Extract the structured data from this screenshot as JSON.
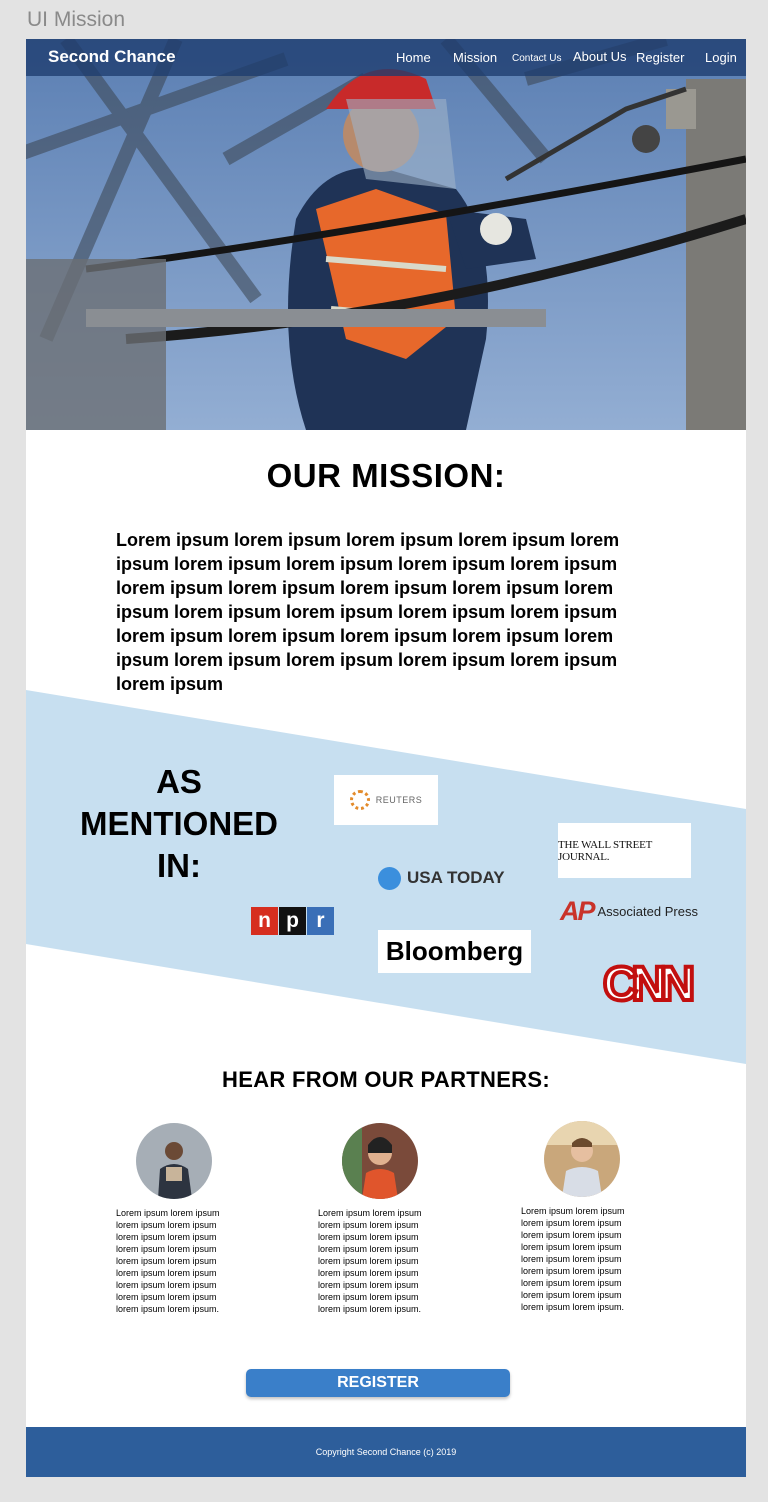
{
  "window": {
    "title": "UI Mission"
  },
  "nav": {
    "brand": "Second Chance",
    "items": [
      "Home",
      "Mission",
      "Contact Us",
      "About Us",
      "Register",
      "Login"
    ]
  },
  "mission": {
    "title": "OUR MISSION:",
    "body": "Lorem ipsum lorem ipsum lorem ipsum lorem ipsum lorem ipsum lorem ipsum lorem ipsum lorem ipsum lorem ipsum lorem ipsum  lorem ipsum lorem ipsum lorem ipsum lorem ipsum lorem ipsum lorem ipsum lorem ipsum lorem ipsum lorem ipsum  lorem ipsum lorem ipsum lorem ipsum lorem ipsum lorem ipsum lorem ipsum lorem ipsum lorem ipsum lorem ipsum"
  },
  "mentioned": {
    "title": "AS MENTIONED IN:",
    "logos": {
      "reuters": "REUTERS",
      "wsj": "THE WALL STREET JOURNAL.",
      "usatoday": "USA TODAY",
      "ap_mark": "AP",
      "ap_text": "Associated Press",
      "npr": [
        "n",
        "p",
        "r"
      ],
      "bloomberg": "Bloomberg",
      "cnn": "CNN"
    },
    "band_color": "#c7dff0"
  },
  "partners": {
    "title": "HEAR FROM OUR PARTNERS:",
    "testimonials": [
      "Lorem ipsum lorem ipsum lorem ipsum lorem ipsum lorem ipsum lorem ipsum lorem ipsum lorem ipsum lorem ipsum lorem ipsum lorem ipsum lorem ipsum lorem ipsum lorem ipsum lorem ipsum lorem ipsum lorem ipsum lorem ipsum.",
      "Lorem ipsum lorem ipsum lorem ipsum lorem ipsum lorem ipsum lorem ipsum lorem ipsum lorem ipsum lorem ipsum lorem ipsum lorem ipsum lorem ipsum lorem ipsum lorem ipsum lorem ipsum lorem ipsum lorem ipsum lorem ipsum.",
      "Lorem ipsum lorem ipsum lorem ipsum lorem ipsum lorem ipsum lorem ipsum lorem ipsum lorem ipsum lorem ipsum lorem ipsum lorem ipsum lorem ipsum lorem ipsum lorem ipsum lorem ipsum lorem ipsum lorem ipsum lorem ipsum."
    ]
  },
  "register": {
    "label": "REGISTER"
  },
  "footer": {
    "copyright": "Copyright Second Chance (c) 2019"
  },
  "colors": {
    "nav": "#1e3c6e",
    "button": "#3a7fc9",
    "footer": "#2d5e9b"
  }
}
